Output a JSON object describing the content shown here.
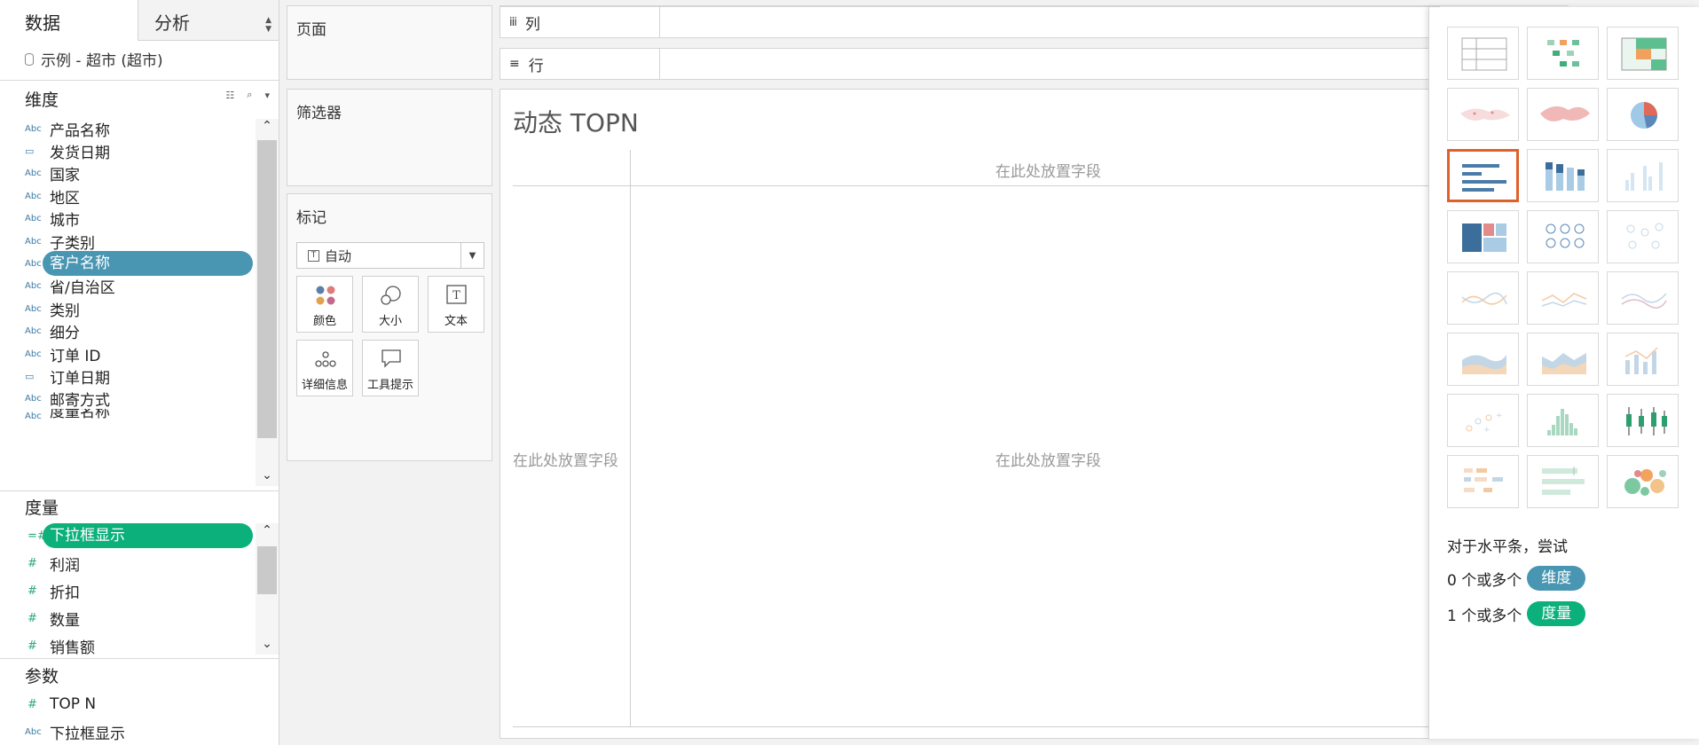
{
  "tabs": {
    "data": "数据",
    "analysis": "分析"
  },
  "datasource": "示例 - 超市 (超市)",
  "dimensions": {
    "title": "维度",
    "items": [
      {
        "type": "Abc",
        "name": "产品名称"
      },
      {
        "type": "date",
        "name": "发货日期"
      },
      {
        "type": "Abc",
        "name": "国家"
      },
      {
        "type": "Abc",
        "name": "地区"
      },
      {
        "type": "Abc",
        "name": "城市"
      },
      {
        "type": "Abc",
        "name": "子类别"
      },
      {
        "type": "Abc",
        "name": "客户名称",
        "selected": true
      },
      {
        "type": "Abc",
        "name": "省/自治区"
      },
      {
        "type": "Abc",
        "name": "类别"
      },
      {
        "type": "Abc",
        "name": "细分"
      },
      {
        "type": "Abc",
        "name": "订单 ID"
      },
      {
        "type": "date",
        "name": "订单日期"
      },
      {
        "type": "Abc",
        "name": "邮寄方式"
      },
      {
        "type": "Abc",
        "name": "度量名称"
      }
    ]
  },
  "measures": {
    "title": "度量",
    "items": [
      {
        "type": "#",
        "name": "下拉框显示",
        "selected": true
      },
      {
        "type": "#",
        "name": "利润"
      },
      {
        "type": "#",
        "name": "折扣"
      },
      {
        "type": "#",
        "name": "数量"
      },
      {
        "type": "#",
        "name": "销售额"
      }
    ]
  },
  "parameters": {
    "title": "参数",
    "items": [
      {
        "type": "#",
        "name": "TOP N"
      },
      {
        "type": "Abc",
        "name": "下拉框显示"
      }
    ]
  },
  "cards": {
    "pages": "页面",
    "filters": "筛选器",
    "marks": "标记",
    "mark_type": "自动",
    "mark_buttons": {
      "color": "颜色",
      "size": "大小",
      "text": "文本",
      "detail": "详细信息",
      "tooltip": "工具提示"
    }
  },
  "shelves": {
    "columns": "列",
    "rows": "行"
  },
  "sheet": {
    "title": "动态 TOPN",
    "drop_top": "在此处放置字段",
    "drop_left": "在此处放置字段",
    "drop_center": "在此处放置字段"
  },
  "showme": {
    "hint_title": "对于水平条，尝试",
    "hint_dim_prefix": "0 个或多个",
    "hint_dim_badge": "维度",
    "hint_mea_prefix": "1 个或多个",
    "hint_mea_badge": "度量",
    "selected_chart": "horizontal-bars",
    "charts": [
      "text-table",
      "heat-map",
      "highlight-table",
      "symbol-map",
      "filled-map",
      "pie",
      "horizontal-bars",
      "stacked-bars",
      "side-by-side-bars",
      "treemap",
      "circle-views",
      "side-by-side-circles",
      "lines-continuous",
      "lines-discrete",
      "dual-lines",
      "area-continuous",
      "area-discrete",
      "dual-combination",
      "scatter-plot",
      "histogram",
      "box-and-whisker",
      "gantt-chart",
      "bullet-graph",
      "packed-bubbles"
    ]
  },
  "colors": {
    "dimension": "#4996b2",
    "measure": "#0bb07b",
    "selection": "#e0602a"
  }
}
